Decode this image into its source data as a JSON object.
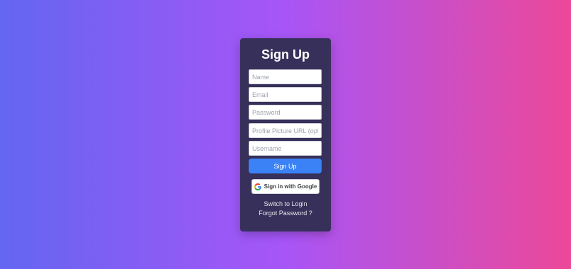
{
  "form": {
    "title": "Sign Up",
    "fields": [
      {
        "placeholder": "Name",
        "value": ""
      },
      {
        "placeholder": "Email",
        "value": ""
      },
      {
        "placeholder": "Password",
        "value": ""
      },
      {
        "placeholder": "Profile Picture URL (optional)",
        "value": ""
      },
      {
        "placeholder": "Username",
        "value": ""
      }
    ],
    "submit_label": "Sign Up",
    "google_label": "Sign in with Google",
    "google_icon": "google-g-icon",
    "switch_label": "Switch to Login",
    "forgot_label": "Forgot Password ?"
  },
  "colors": {
    "background_gradient": [
      "#6366f1",
      "#a855f7",
      "#ec4899"
    ],
    "card": "#37305a",
    "primary": "#3b82f6"
  }
}
